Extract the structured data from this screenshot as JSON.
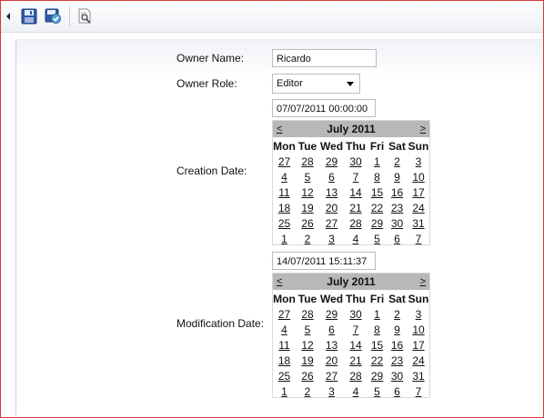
{
  "toolbar": {
    "icons": [
      "save-icon",
      "save-all-icon",
      "preview-icon"
    ]
  },
  "form": {
    "owner_name_label": "Owner Name:",
    "owner_name_value": "Ricardo",
    "owner_role_label": "Owner Role:",
    "owner_role_value": "Editor",
    "creation_date_label": "Creation Date:",
    "creation_date_value": "07/07/2011 00:00:00",
    "modification_date_label": "Modification Date:",
    "modification_date_value": "14/07/2011 15:11:37"
  },
  "calendars": [
    {
      "title": "July 2011",
      "prev": "<",
      "next": ">",
      "weekdays": [
        "Mon",
        "Tue",
        "Wed",
        "Thu",
        "Fri",
        "Sat",
        "Sun"
      ],
      "weeks": [
        [
          "27",
          "28",
          "29",
          "30",
          "1",
          "2",
          "3"
        ],
        [
          "4",
          "5",
          "6",
          "7",
          "8",
          "9",
          "10"
        ],
        [
          "11",
          "12",
          "13",
          "14",
          "15",
          "16",
          "17"
        ],
        [
          "18",
          "19",
          "20",
          "21",
          "22",
          "23",
          "24"
        ],
        [
          "25",
          "26",
          "27",
          "28",
          "29",
          "30",
          "31"
        ],
        [
          "1",
          "2",
          "3",
          "4",
          "5",
          "6",
          "7"
        ]
      ]
    },
    {
      "title": "July 2011",
      "prev": "<",
      "next": ">",
      "weekdays": [
        "Mon",
        "Tue",
        "Wed",
        "Thu",
        "Fri",
        "Sat",
        "Sun"
      ],
      "weeks": [
        [
          "27",
          "28",
          "29",
          "30",
          "1",
          "2",
          "3"
        ],
        [
          "4",
          "5",
          "6",
          "7",
          "8",
          "9",
          "10"
        ],
        [
          "11",
          "12",
          "13",
          "14",
          "15",
          "16",
          "17"
        ],
        [
          "18",
          "19",
          "20",
          "21",
          "22",
          "23",
          "24"
        ],
        [
          "25",
          "26",
          "27",
          "28",
          "29",
          "30",
          "31"
        ],
        [
          "1",
          "2",
          "3",
          "4",
          "5",
          "6",
          "7"
        ]
      ]
    }
  ]
}
